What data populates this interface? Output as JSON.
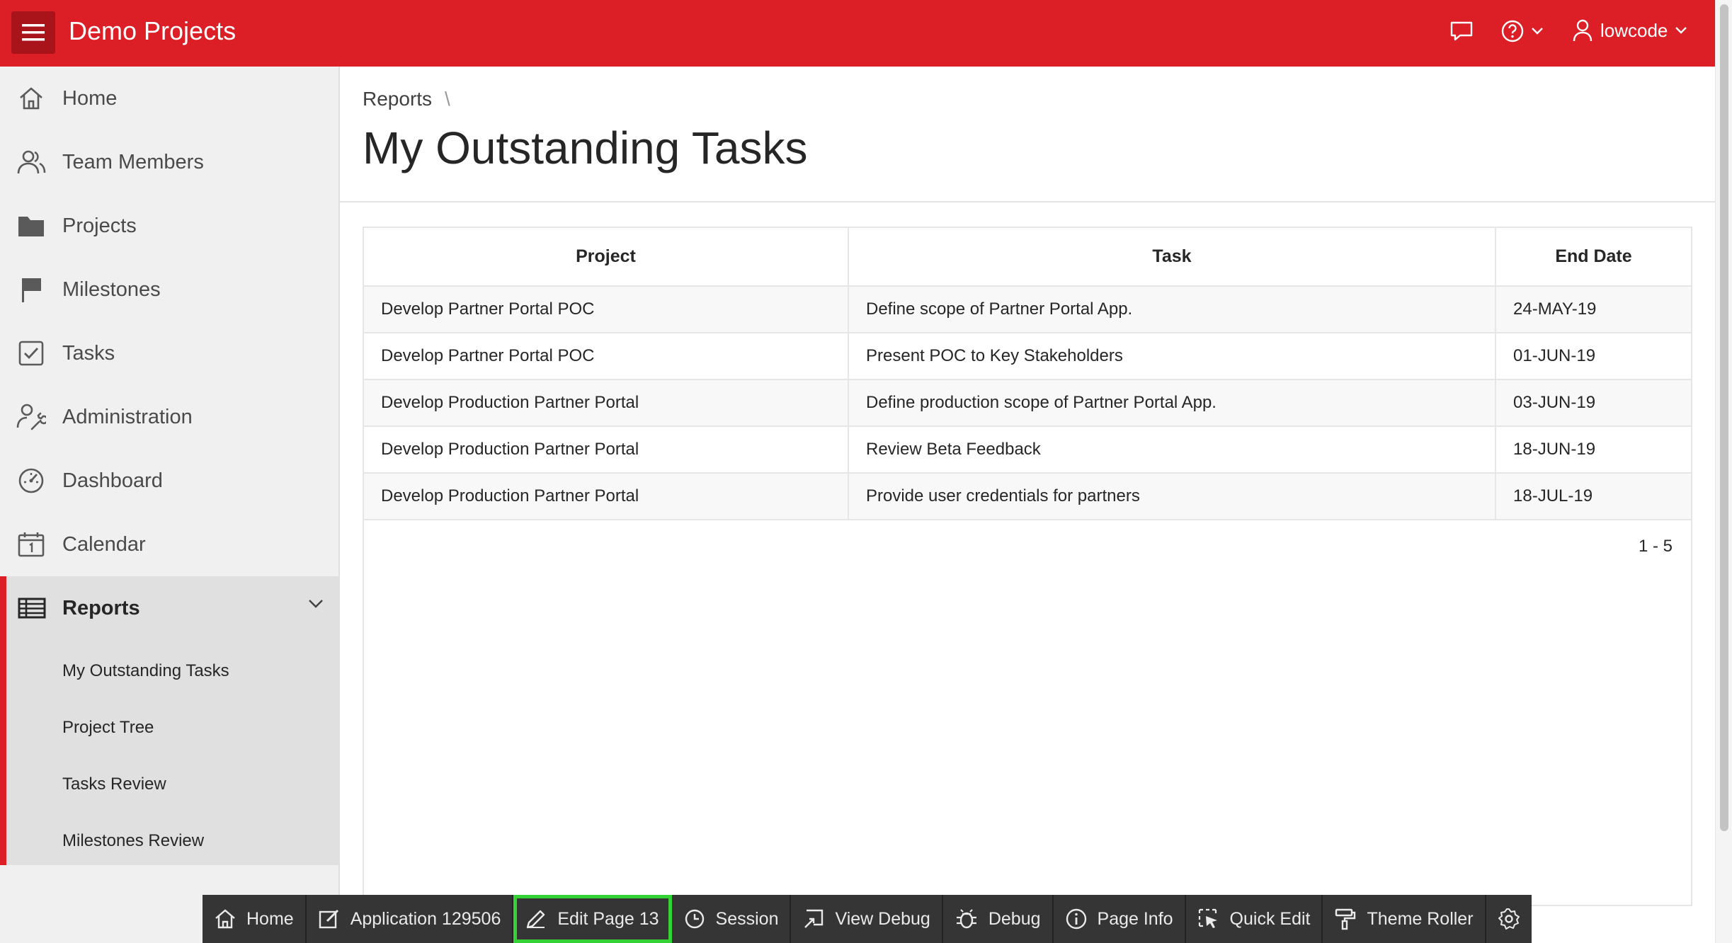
{
  "header": {
    "app_title": "Demo Projects",
    "user_name": "lowcode",
    "brand_color": "#dc1f27"
  },
  "sidebar": {
    "items": [
      {
        "label": "Home",
        "icon": "home-icon"
      },
      {
        "label": "Team Members",
        "icon": "users-icon"
      },
      {
        "label": "Projects",
        "icon": "folder-icon"
      },
      {
        "label": "Milestones",
        "icon": "flag-icon"
      },
      {
        "label": "Tasks",
        "icon": "checkbox-icon"
      },
      {
        "label": "Administration",
        "icon": "user-wrench-icon"
      },
      {
        "label": "Dashboard",
        "icon": "gauge-icon"
      },
      {
        "label": "Calendar",
        "icon": "calendar-icon"
      },
      {
        "label": "Reports",
        "icon": "table-icon",
        "expanded": true
      }
    ],
    "sub_items": [
      {
        "label": "My Outstanding Tasks"
      },
      {
        "label": "Project Tree"
      },
      {
        "label": "Tasks Review"
      },
      {
        "label": "Milestones Review"
      }
    ]
  },
  "breadcrumb": {
    "parent": "Reports",
    "separator": "\\"
  },
  "page": {
    "title": "My Outstanding Tasks"
  },
  "report": {
    "columns": [
      "Project",
      "Task",
      "End Date"
    ],
    "rows": [
      [
        "Develop Partner Portal POC",
        "Define scope of Partner Portal App.",
        "24-MAY-19"
      ],
      [
        "Develop Partner Portal POC",
        "Present POC to Key Stakeholders",
        "01-JUN-19"
      ],
      [
        "Develop Production Partner Portal",
        "Define production scope of Partner Portal App.",
        "03-JUN-19"
      ],
      [
        "Develop Production Partner Portal",
        "Review Beta Feedback",
        "18-JUN-19"
      ],
      [
        "Develop Production Partner Portal",
        "Provide user credentials for partners",
        "18-JUL-19"
      ]
    ],
    "pagination": "1 - 5"
  },
  "devbar": {
    "buttons": [
      {
        "label": "Home",
        "icon": "home-icon"
      },
      {
        "label": "Application 129506",
        "icon": "edit-square-icon"
      },
      {
        "label": "Edit Page 13",
        "icon": "pencil-icon",
        "highlighted": true
      },
      {
        "label": "Session",
        "icon": "clock-icon"
      },
      {
        "label": "View Debug",
        "icon": "view-debug-icon"
      },
      {
        "label": "Debug",
        "icon": "bug-icon"
      },
      {
        "label": "Page Info",
        "icon": "info-icon"
      },
      {
        "label": "Quick Edit",
        "icon": "cursor-select-icon"
      },
      {
        "label": "Theme Roller",
        "icon": "paint-roller-icon"
      },
      {
        "label": "",
        "icon": "gear-icon"
      }
    ],
    "highlight_color": "#34d234"
  }
}
